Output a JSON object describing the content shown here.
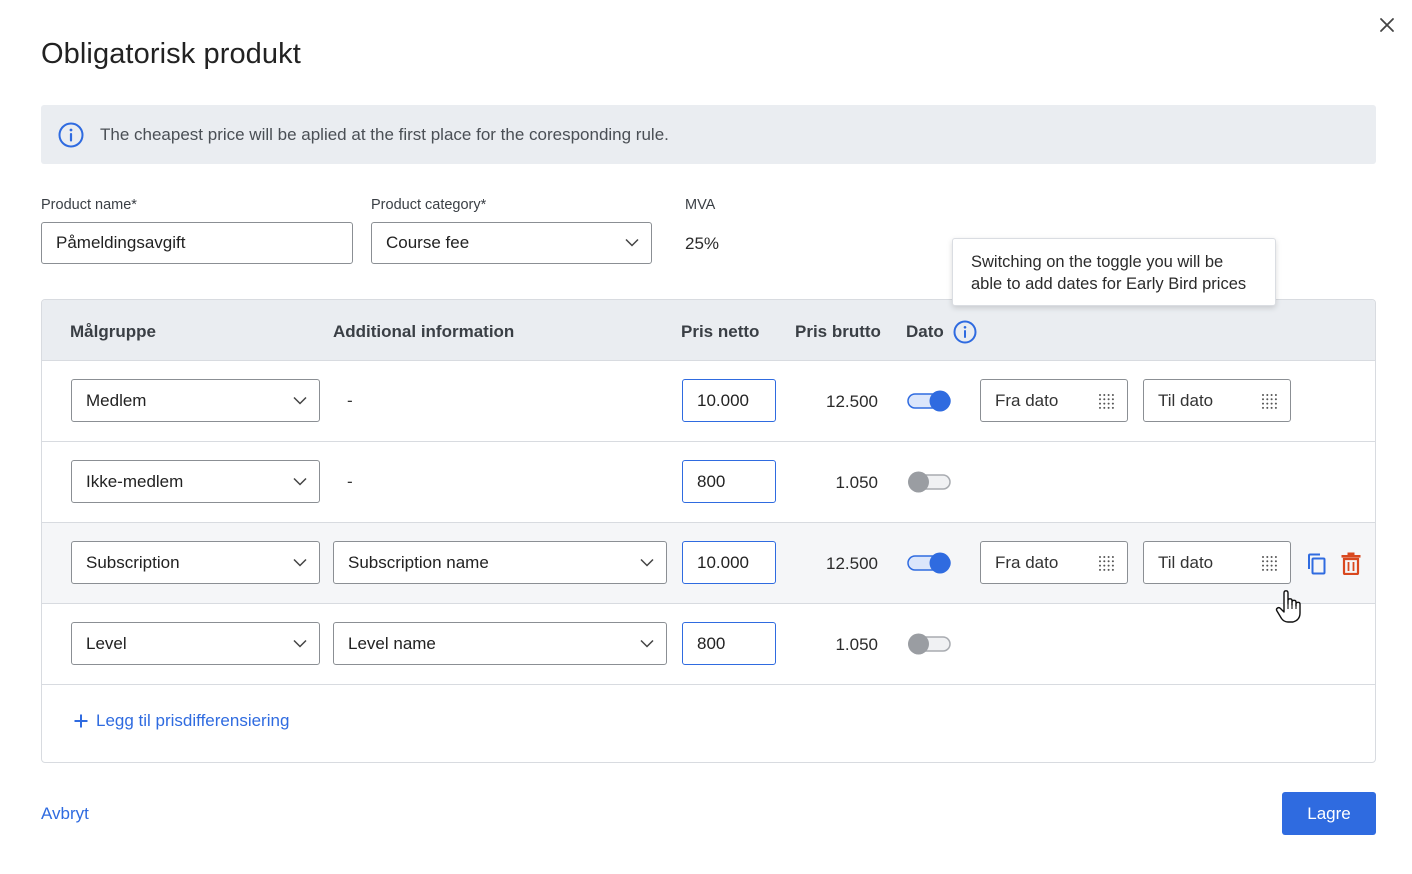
{
  "dialog": {
    "title": "Obligatorisk produkt",
    "info_banner": "The cheapest price will be aplied at the first place for the coresponding rule."
  },
  "form": {
    "product_name_label": "Product name*",
    "product_name_value": "Påmeldingsavgift",
    "product_category_label": "Product category*",
    "product_category_value": "Course fee",
    "mva_label": "MVA",
    "mva_value": "25%"
  },
  "tooltip": {
    "line1": "Switching on the toggle you will be",
    "line2": "able to add dates for Early Bird prices"
  },
  "table": {
    "headers": {
      "malgruppe": "Målgruppe",
      "additional": "Additional information",
      "pris_netto": "Pris netto",
      "pris_brutto": "Pris brutto",
      "dato": "Dato"
    },
    "rows": [
      {
        "group": "Medlem",
        "additional": "-",
        "netto": "10.000",
        "brutto": "12.500",
        "toggle_on": true,
        "fra": "Fra dato",
        "til": "Til dato"
      },
      {
        "group": "Ikke-medlem",
        "additional": "-",
        "netto": "800",
        "brutto": "1.050",
        "toggle_on": false
      },
      {
        "group": "Subscription",
        "additional": "Subscription name",
        "netto": "10.000",
        "brutto": "12.500",
        "toggle_on": true,
        "fra": "Fra dato",
        "til": "Til dato"
      },
      {
        "group": "Level",
        "additional": "Level name",
        "netto": "800",
        "brutto": "1.050",
        "toggle_on": false
      }
    ],
    "add_link": "Legg til prisdifferensiering"
  },
  "footer": {
    "cancel": "Avbryt",
    "save": "Lagre"
  },
  "colors": {
    "accent": "#2f6be0",
    "banner_bg": "#eaedf1",
    "delete": "#d9481f"
  }
}
